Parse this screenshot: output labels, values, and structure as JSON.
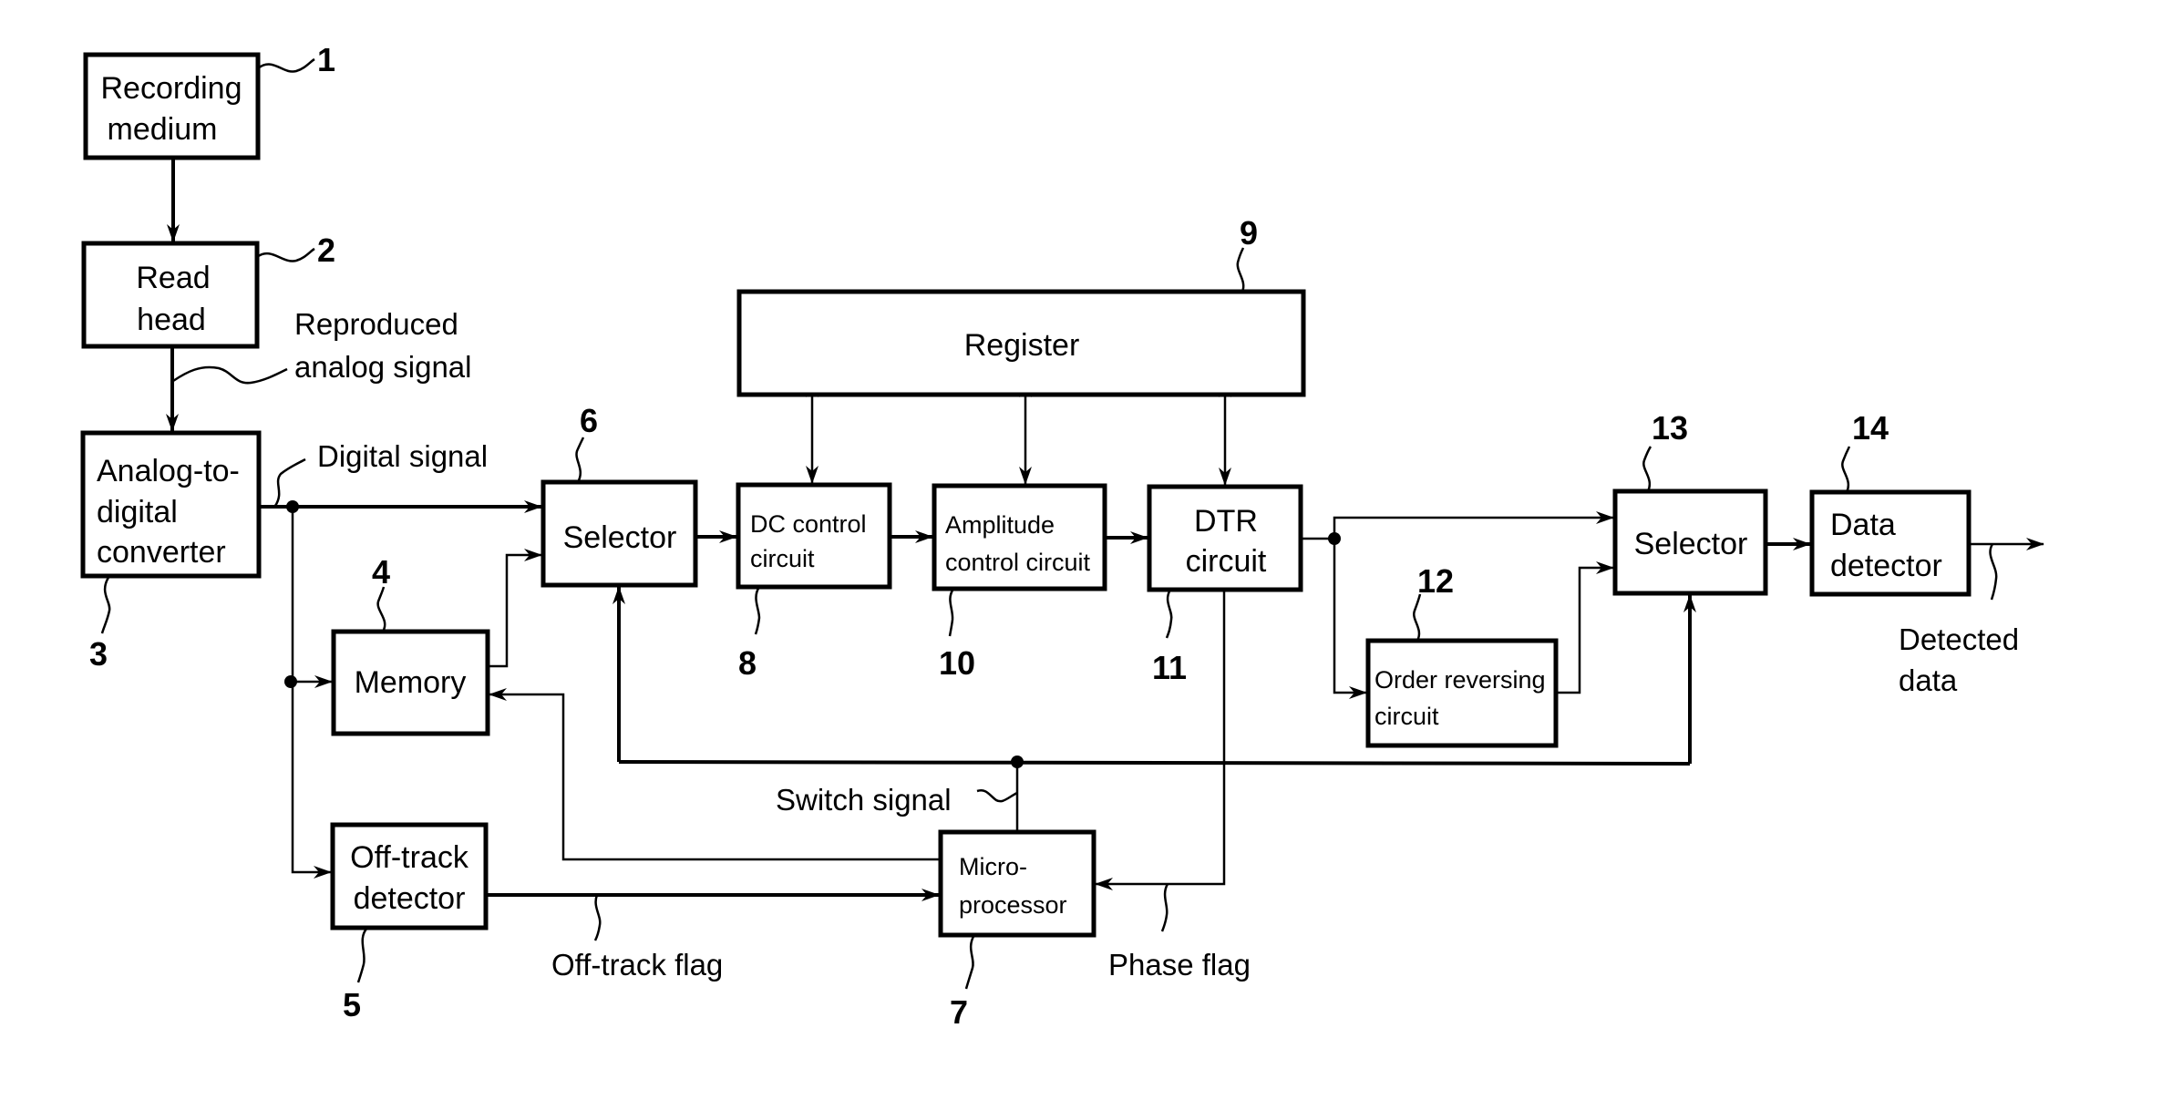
{
  "figure": {
    "blocks": [
      {
        "id": "1",
        "lines": [
          "Recording",
          "medium"
        ]
      },
      {
        "id": "2",
        "lines": [
          "Read",
          "head"
        ]
      },
      {
        "id": "3",
        "lines": [
          "Analog-to-",
          "digital",
          "converter"
        ]
      },
      {
        "id": "4",
        "lines": [
          "Memory"
        ]
      },
      {
        "id": "5",
        "lines": [
          "Off-track",
          "detector"
        ]
      },
      {
        "id": "6",
        "lines": [
          "Selector"
        ]
      },
      {
        "id": "7",
        "lines": [
          "Micro-",
          "processor"
        ]
      },
      {
        "id": "8",
        "lines": [
          "DC control",
          "circuit"
        ]
      },
      {
        "id": "9",
        "lines": [
          "Register"
        ]
      },
      {
        "id": "10",
        "lines": [
          "Amplitude",
          "control circuit"
        ]
      },
      {
        "id": "11",
        "lines": [
          "DTR",
          "circuit"
        ]
      },
      {
        "id": "12",
        "lines": [
          "Order reversing",
          "circuit"
        ]
      },
      {
        "id": "13",
        "lines": [
          "Selector"
        ]
      },
      {
        "id": "14",
        "lines": [
          "Data",
          "detector"
        ]
      }
    ],
    "signals": {
      "reproduced_analog": [
        "Reproduced",
        "analog signal"
      ],
      "digital": "Digital signal",
      "switch": "Switch signal",
      "off_track_flag": "Off-track flag",
      "phase_flag": "Phase flag",
      "detected_data": [
        "Detected",
        "data"
      ]
    },
    "connections": [
      {
        "from": "1",
        "to": "2"
      },
      {
        "from": "2",
        "to": "3",
        "label": "reproduced_analog"
      },
      {
        "from": "3",
        "to": "6",
        "label": "digital"
      },
      {
        "from": "3",
        "to": "4"
      },
      {
        "from": "3",
        "to": "5"
      },
      {
        "from": "4",
        "to": "6"
      },
      {
        "from": "6",
        "to": "8"
      },
      {
        "from": "8",
        "to": "10"
      },
      {
        "from": "10",
        "to": "11"
      },
      {
        "from": "9",
        "to": "8",
        "bidirectional": true
      },
      {
        "from": "9",
        "to": "10",
        "bidirectional": true
      },
      {
        "from": "9",
        "to": "11",
        "bidirectional": true
      },
      {
        "from": "11",
        "to": "13"
      },
      {
        "from": "11",
        "to": "12"
      },
      {
        "from": "12",
        "to": "13"
      },
      {
        "from": "13",
        "to": "14"
      },
      {
        "from": "14",
        "to": "output",
        "label": "detected_data"
      },
      {
        "from": "5",
        "to": "7",
        "label": "off_track_flag"
      },
      {
        "from": "11",
        "to": "7",
        "label": "phase_flag"
      },
      {
        "from": "7",
        "to": "4"
      },
      {
        "from": "7",
        "to": "6",
        "label": "switch"
      },
      {
        "from": "7",
        "to": "13",
        "label": "switch"
      }
    ]
  }
}
